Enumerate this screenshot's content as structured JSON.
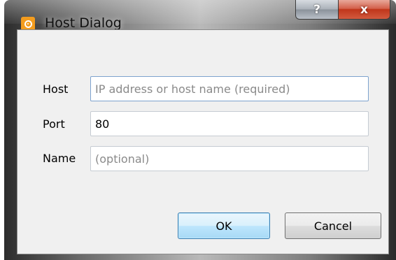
{
  "window": {
    "title": "Host Dialog",
    "icon": "app-icon",
    "help_label": "?",
    "close_label": "x"
  },
  "form": {
    "host": {
      "label": "Host",
      "value": "",
      "placeholder": "IP address or host name (required)"
    },
    "port": {
      "label": "Port",
      "value": "80",
      "placeholder": ""
    },
    "name": {
      "label": "Name",
      "value": "",
      "placeholder": "(optional)"
    }
  },
  "buttons": {
    "ok_label": "OK",
    "cancel_label": "Cancel"
  },
  "colors": {
    "app_icon": "#f39c1e",
    "close_button": "#c0361b",
    "default_button_border": "#3c7fb1"
  }
}
